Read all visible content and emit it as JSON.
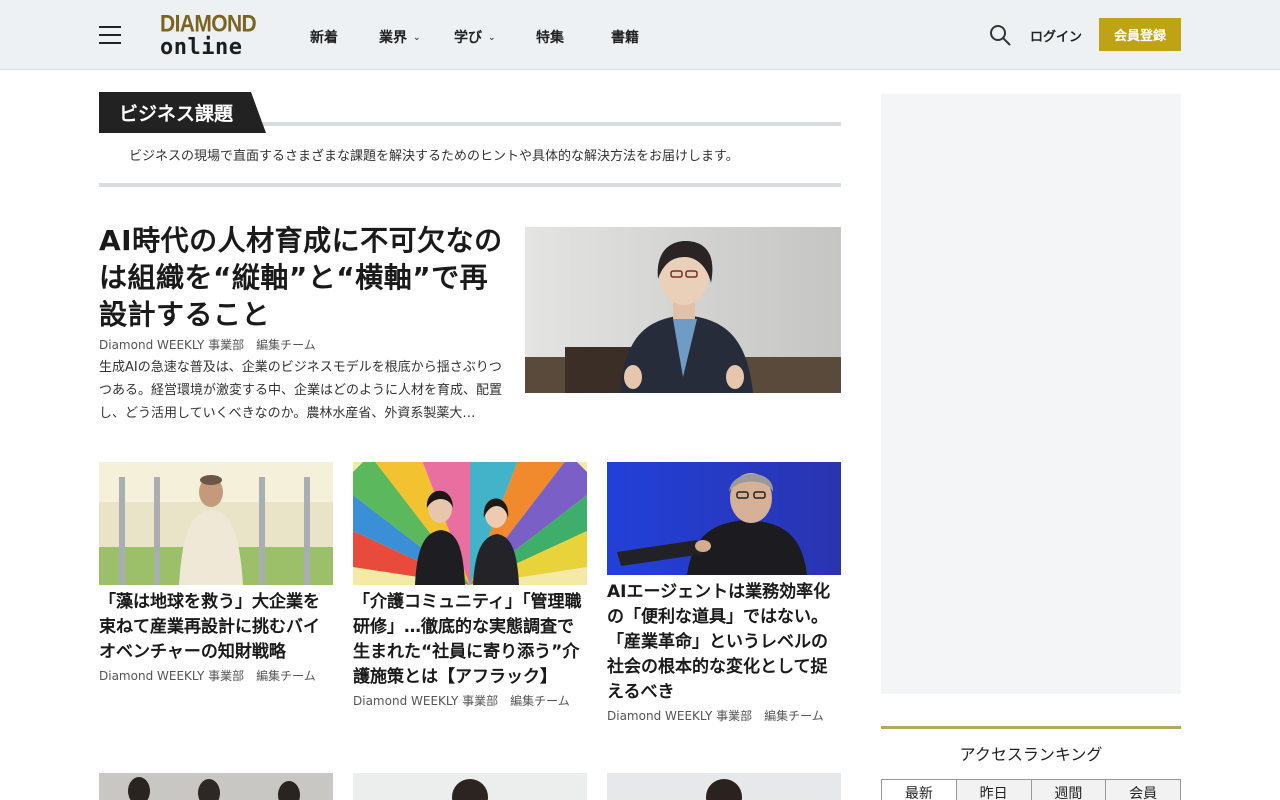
{
  "header": {
    "logo_line1": "DIAMOND",
    "logo_line2": "online",
    "nav": [
      {
        "label": "新着",
        "dropdown": false
      },
      {
        "label": "業界",
        "dropdown": true
      },
      {
        "label": "学び",
        "dropdown": true
      },
      {
        "label": "特集",
        "dropdown": false
      },
      {
        "label": "書籍",
        "dropdown": false
      }
    ],
    "login_label": "ログイン",
    "register_label": "会員登録",
    "accent_color": "#c0a215"
  },
  "section": {
    "label": "ビジネス課題",
    "description": "ビジネスの現場で直面するさまざまな課題を解決するためのヒントや具体的な解決方法をお届けします。"
  },
  "feature": {
    "title": "AI時代の人材育成に不可欠なのは組織を“縦軸”と“横軸”で再設計すること",
    "author": "Diamond WEEKLY 事業部　編集チーム",
    "description": "生成AIの急速な普及は、企業のビジネスモデルを根底から揺さぶりつつある。経営環境が激変する中、企業はどのように人材を育成、配置し、どう活用していくべきなのか。農林水産省、外資系製薬大…"
  },
  "cards": [
    {
      "title": "「藻は地球を救う」大企業を束ねて産業再設計に挑むバイオベンチャーの知財戦略",
      "author": "Diamond WEEKLY 事業部　編集チーム"
    },
    {
      "title": "「介護コミュニティ」「管理職研修」…徹底的な実態調査で生まれた“社員に寄り添う”介護施策とは【アフラック】",
      "author": "Diamond WEEKLY 事業部　編集チーム"
    },
    {
      "title": "AIエージェントは業務効率化の「便利な道具」ではない。「産業革命」というレベルの社会の根本的な変化として捉えるべき",
      "author": "Diamond WEEKLY 事業部　編集チーム"
    }
  ],
  "sidebar": {
    "ranking_title": "アクセスランキング",
    "tabs": [
      "最新",
      "昨日",
      "週間",
      "会員"
    ],
    "active_tab": "最新"
  }
}
